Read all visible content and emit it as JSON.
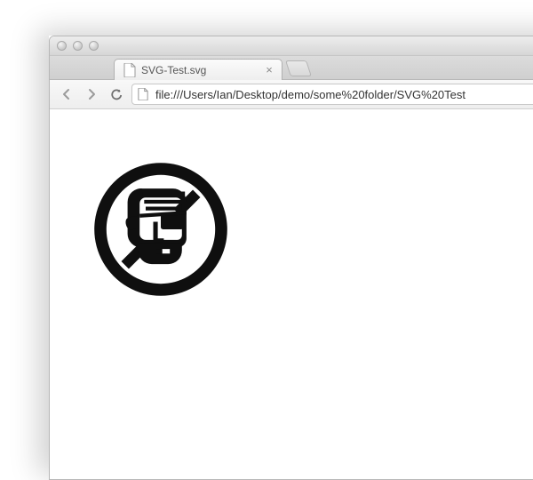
{
  "tab": {
    "title": "SVG-Test.svg",
    "favicon": "file-icon"
  },
  "toolbar": {
    "back": "back-icon",
    "forward": "forward-icon",
    "reload": "reload-icon",
    "scheme_icon": "file-icon"
  },
  "address_bar": {
    "url": "file:///Users/Ian/Desktop/demo/some%20folder/SVG%20Test"
  },
  "page": {
    "image_name": "no-piracy-icon"
  }
}
